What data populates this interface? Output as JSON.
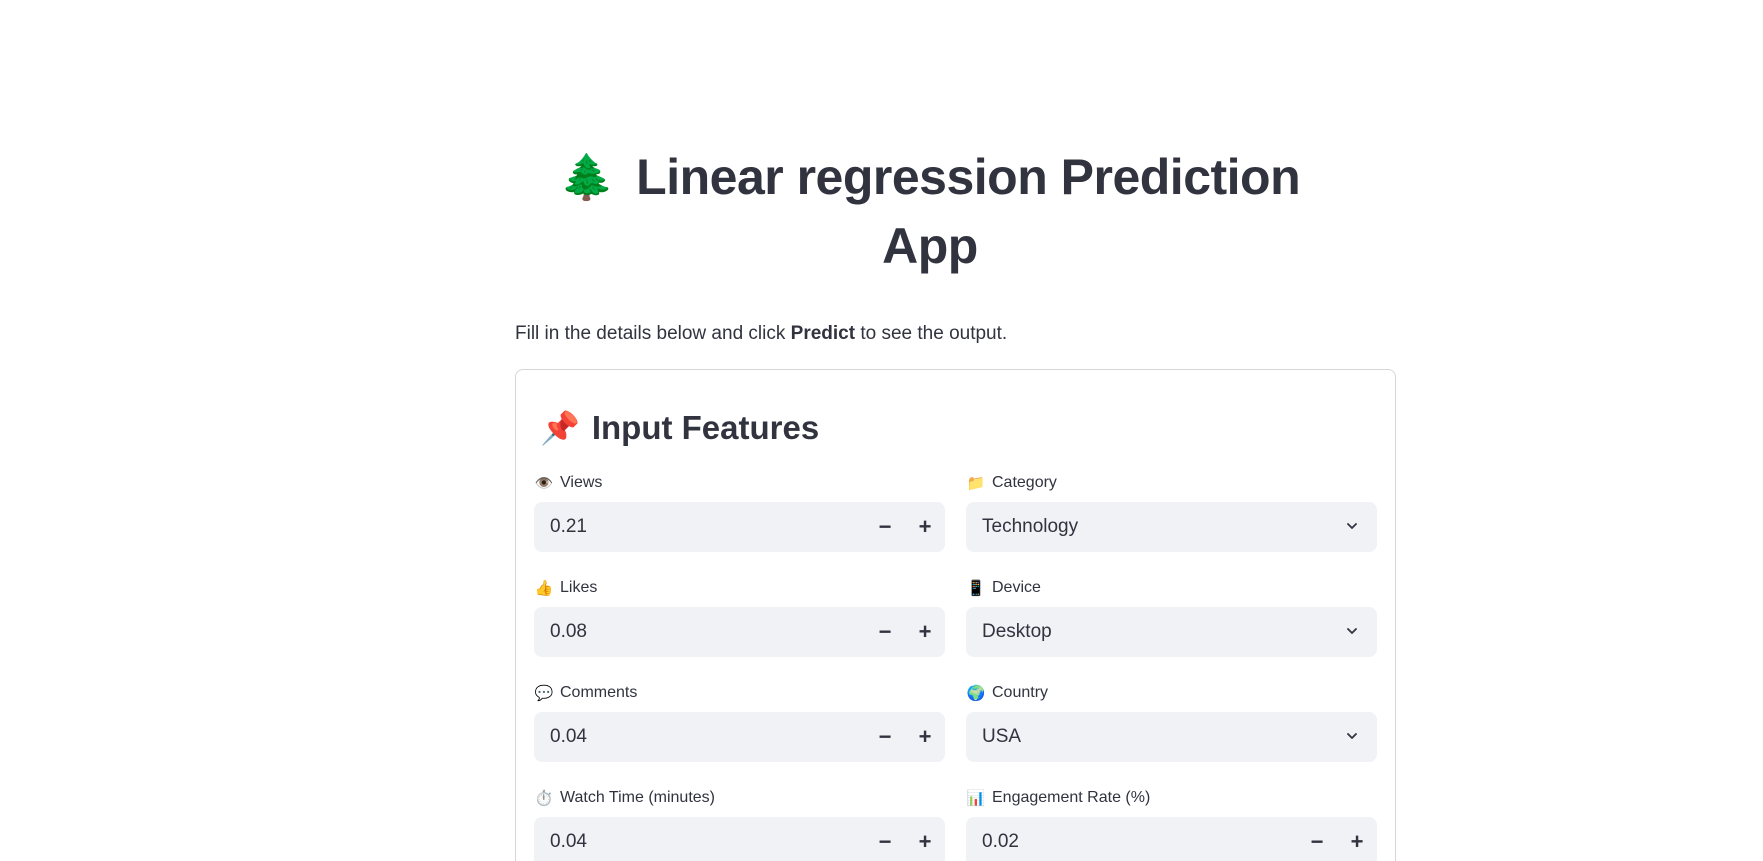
{
  "header": {
    "title_icon": "🌲",
    "title_text": "Linear regression Prediction App"
  },
  "intro": {
    "prefix": "Fill in the details below and click ",
    "bold": "Predict",
    "suffix": " to see the output."
  },
  "form": {
    "title_icon": "📌",
    "title_text": "Input Features",
    "fields": {
      "views": {
        "icon": "👁️",
        "label": "Views",
        "value": "0.21"
      },
      "likes": {
        "icon": "👍",
        "label": "Likes",
        "value": "0.08"
      },
      "comments": {
        "icon": "💬",
        "label": "Comments",
        "value": "0.04"
      },
      "watch_time": {
        "icon": "⏱️",
        "label": "Watch Time (minutes)",
        "value": "0.04"
      },
      "category": {
        "icon": "📁",
        "label": "Category",
        "selected": "Technology"
      },
      "device": {
        "icon": "📱",
        "label": "Device",
        "selected": "Desktop"
      },
      "country": {
        "icon": "🌍",
        "label": "Country",
        "selected": "USA"
      },
      "engagement_rate": {
        "icon": "📊",
        "label": "Engagement Rate (%)",
        "value": "0.02"
      }
    },
    "stepper_minus": "−",
    "stepper_plus": "+"
  },
  "colors": {
    "text": "#31333f",
    "input_bg": "#f0f2f6",
    "border": "#d6d6d9"
  }
}
